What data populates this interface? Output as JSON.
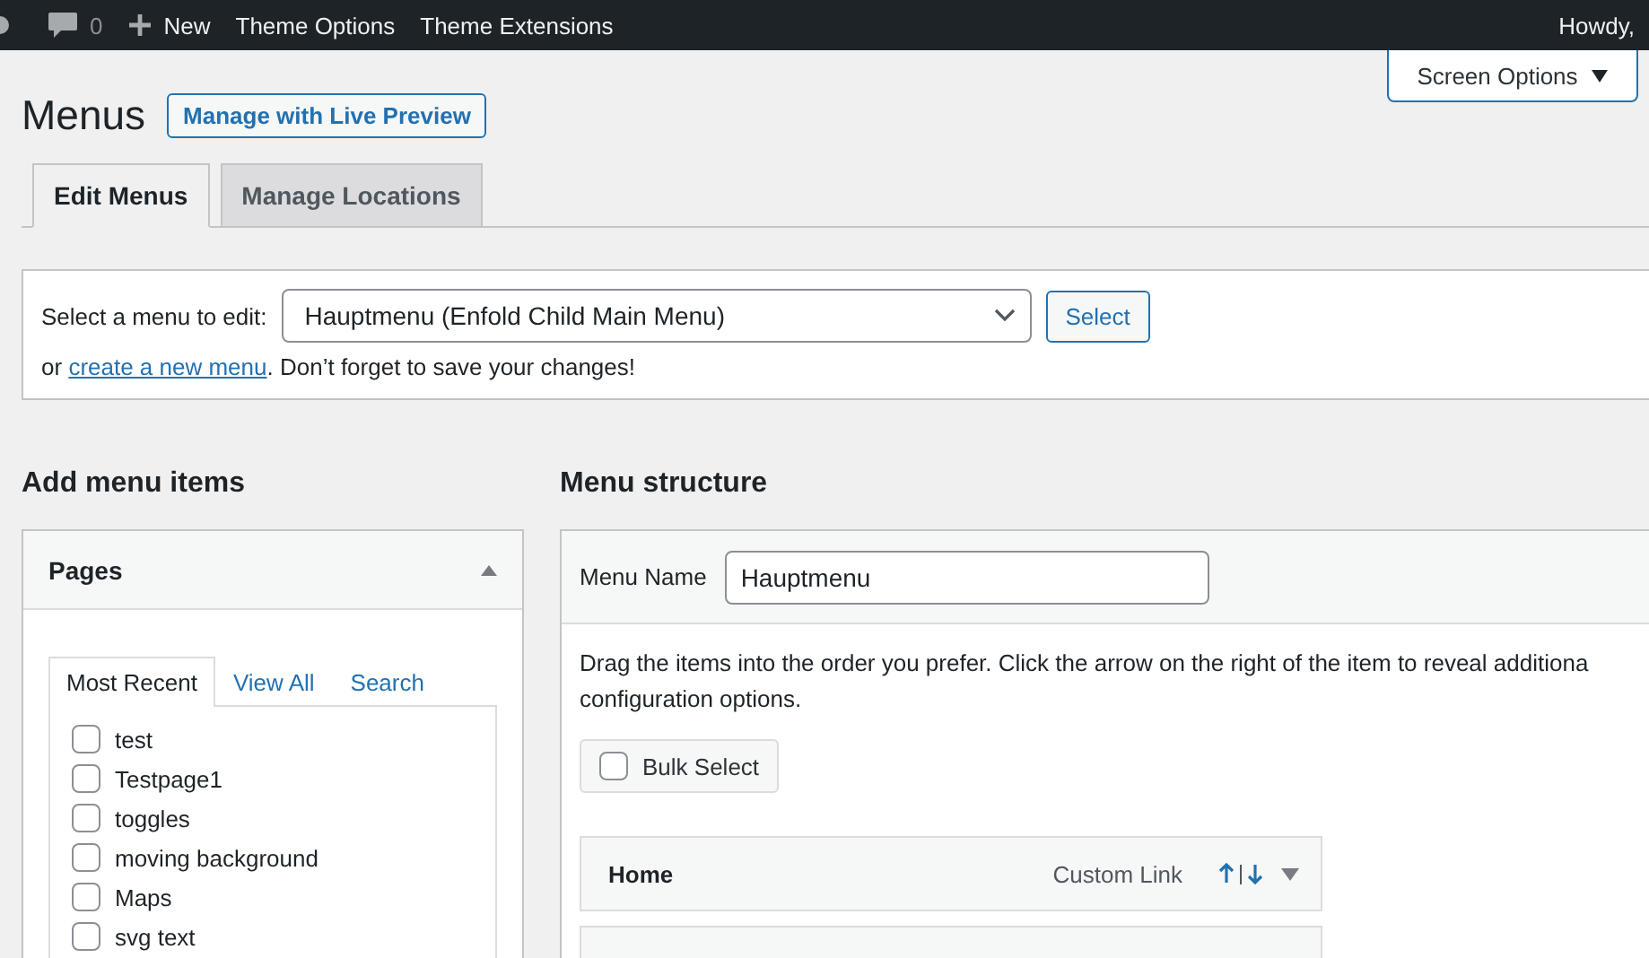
{
  "admin_bar": {
    "comments_count": "0",
    "new_label": "New",
    "links": [
      "Theme Options",
      "Theme Extensions"
    ],
    "greeting": "Howdy,"
  },
  "screen_options": {
    "label": "Screen Options"
  },
  "page": {
    "title": "Menus",
    "action": "Manage with Live Preview"
  },
  "tabs": [
    {
      "label": "Edit Menus",
      "selected": true
    },
    {
      "label": "Manage Locations",
      "selected": false
    }
  ],
  "menu_select": {
    "label": "Select a menu to edit:",
    "value": "Hauptmenu (Enfold Child Main Menu)",
    "button": "Select",
    "note_prefix": "or",
    "link": "create a new menu",
    "note_suffix": ". Don’t forget to save your changes!"
  },
  "add_items": {
    "heading": "Add menu items",
    "panel": {
      "title": "Pages",
      "expanded": true,
      "tabs": [
        {
          "label": "Most Recent",
          "selected": true
        },
        {
          "label": "View All",
          "selected": false
        },
        {
          "label": "Search",
          "selected": false
        }
      ],
      "items": [
        {
          "label": "test",
          "checked": false
        },
        {
          "label": "Testpage1",
          "checked": false
        },
        {
          "label": "toggles",
          "checked": false
        },
        {
          "label": "moving background",
          "checked": false
        },
        {
          "label": "Maps",
          "checked": false
        },
        {
          "label": "svg text",
          "checked": false
        }
      ]
    }
  },
  "structure": {
    "heading": "Menu structure",
    "name_label": "Menu Name",
    "name_value": "Hauptmenu",
    "instructions": "Drag the items into the order you prefer. Click the arrow on the right of the item to reveal additiona configuration options.",
    "bulk_select": {
      "label": "Bulk Select",
      "checked": false
    },
    "items": [
      {
        "title": "Home",
        "type": "Custom Link"
      }
    ]
  }
}
